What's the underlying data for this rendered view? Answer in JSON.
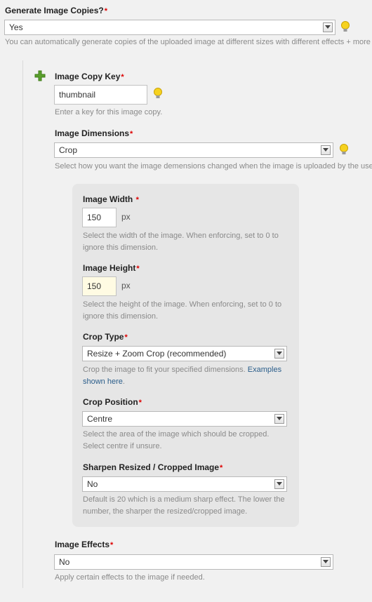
{
  "generate_copies": {
    "label": "Generate Image Copies?",
    "required_mark": "*",
    "value": "Yes",
    "hint": "You can automatically generate copies of the uploaded image at different sizes with different effects + more"
  },
  "copy_key": {
    "label": "Image Copy Key",
    "required_mark": "*",
    "value": "thumbnail",
    "hint": "Enter a key for this image copy."
  },
  "dimensions": {
    "label": "Image Dimensions",
    "required_mark": "*",
    "value": "Crop",
    "hint": "Select how you want the image demensions changed when the image is uploaded by the use"
  },
  "width": {
    "label": "Image Width",
    "required_mark": "*",
    "value": "150",
    "unit": "px",
    "hint_line1": "Select the width of the image. When enforcing, set to 0 to",
    "hint_line2": "ignore this dimension."
  },
  "height": {
    "label": "Image Height",
    "required_mark": "*",
    "value": "150",
    "unit": "px",
    "hint_line1": "Select the height of the image. When enforcing, set to 0 to",
    "hint_line2": "ignore this dimension."
  },
  "crop_type": {
    "label": "Crop Type",
    "required_mark": "*",
    "value": "Resize + Zoom Crop (recommended)",
    "hint_text": "Crop the image to fit your specified dimensions. ",
    "hint_link_part1": "Examples",
    "hint_link_part2": "shown here",
    "hint_end": "."
  },
  "crop_position": {
    "label": "Crop Position",
    "required_mark": "*",
    "value": "Centre",
    "hint_line1": "Select the area of the image which should be cropped.",
    "hint_line2": "Select centre if unsure."
  },
  "sharpen": {
    "label": "Sharpen Resized / Cropped Image",
    "required_mark": "*",
    "value": "No",
    "hint_line1": "Default is 20 which is a medium sharp effect. The lower the",
    "hint_line2": "number, the sharper the resized/cropped image."
  },
  "effects": {
    "label": "Image Effects",
    "required_mark": "*",
    "value": "No",
    "hint": "Apply certain effects to the image if needed."
  },
  "icons": {
    "add": "plus-icon",
    "tip": "lightbulb-icon",
    "dropdown": "chevron-down-icon"
  },
  "colors": {
    "add_icon": "#5aa02c",
    "required": "#dd0000",
    "link": "#2a5d8a",
    "panel_bg": "#e6e6e6"
  }
}
